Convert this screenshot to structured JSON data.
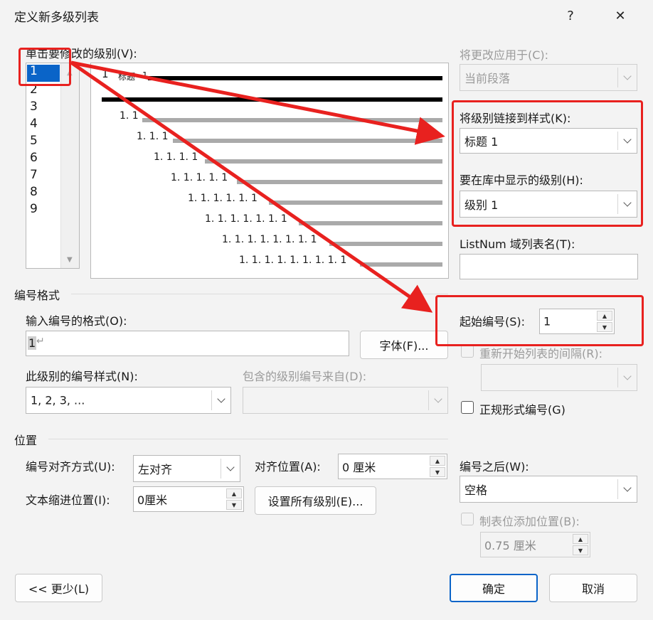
{
  "window": {
    "title": "定义新多级列表",
    "help": "?",
    "close": "✕"
  },
  "level_select": {
    "label": "单击要修改的级别(V):",
    "items": [
      "1",
      "2",
      "3",
      "4",
      "5",
      "6",
      "7",
      "8",
      "9"
    ],
    "selected": "1"
  },
  "preview": {
    "heading_num": "1",
    "heading_text": "标题",
    "heading_suffix": "1",
    "rows": [
      "1. 1",
      "1. 1. 1",
      "1. 1. 1. 1",
      "1. 1. 1. 1. 1",
      "1. 1. 1. 1. 1. 1",
      "1. 1. 1. 1. 1. 1. 1",
      "1. 1. 1. 1. 1. 1. 1. 1",
      "1. 1. 1. 1. 1. 1. 1. 1. 1"
    ]
  },
  "right": {
    "apply_to_label": "将更改应用于(C):",
    "apply_to_value": "当前段落",
    "link_style_label": "将级别链接到样式(K):",
    "link_style_value": "标题 1",
    "gallery_level_label": "要在库中显示的级别(H):",
    "gallery_level_value": "级别 1",
    "listnum_label": "ListNum 域列表名(T):",
    "listnum_value": "",
    "start_at_label": "起始编号(S):",
    "start_at_value": "1",
    "restart_label": "重新开始列表的间隔(R):",
    "restart_value": "",
    "legal_label": "正规形式编号(G)"
  },
  "number_format": {
    "section_title": "编号格式",
    "enter_format_label": "输入编号的格式(O):",
    "format_value": "1",
    "paragraph_mark": "↵",
    "font_button": "字体(F)...",
    "style_label": "此级别的编号样式(N):",
    "style_value": "1, 2, 3, ...",
    "include_label": "包含的级别编号来自(D):",
    "include_value": ""
  },
  "position": {
    "section_title": "位置",
    "align_label": "编号对齐方式(U):",
    "align_value": "左对齐",
    "aligned_at_label": "对齐位置(A):",
    "aligned_at_value": "0 厘米",
    "indent_label": "文本缩进位置(I):",
    "indent_value": "0厘米",
    "set_all_button": "设置所有级别(E)...",
    "follow_label": "编号之后(W):",
    "follow_value": "空格",
    "tab_stop_label": "制表位添加位置(B):",
    "tab_stop_value": "0.75 厘米"
  },
  "footer": {
    "less_button": "<< 更少(L)",
    "ok_button": "确定",
    "cancel_button": "取消"
  },
  "colors": {
    "annotation_red": "#e8211f",
    "primary_blue": "#0a64c8"
  }
}
